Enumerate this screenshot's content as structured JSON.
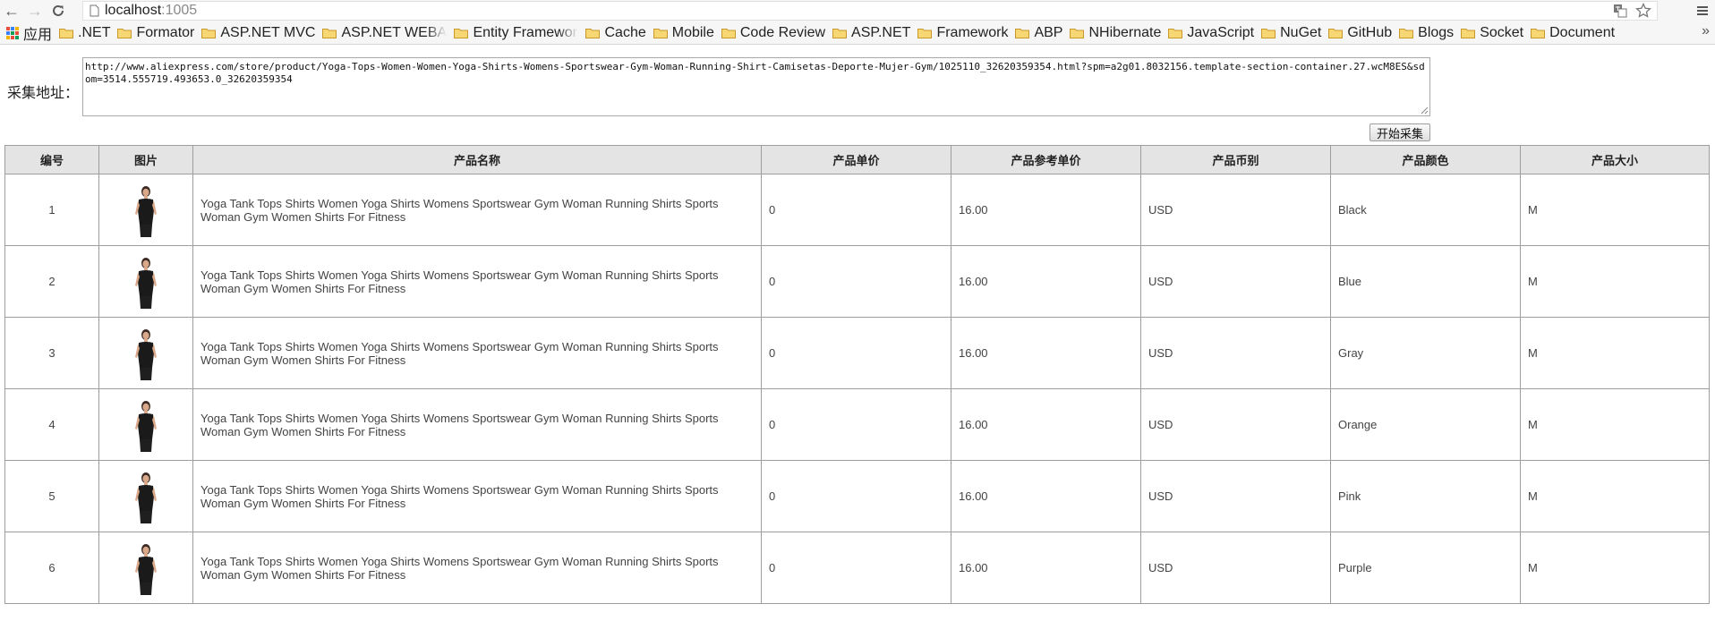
{
  "browser": {
    "url_host": "localhost",
    "url_port": ":1005",
    "bookmarks": [
      {
        "label": "应用",
        "icon": "apps-grid-icon"
      },
      {
        "label": ".NET",
        "icon": "folder-icon"
      },
      {
        "label": "Formator",
        "icon": "folder-icon"
      },
      {
        "label": "ASP.NET MVC",
        "icon": "folder-icon"
      },
      {
        "label": "ASP.NET WEBAF",
        "icon": "folder-icon"
      },
      {
        "label": "Entity Framewor",
        "icon": "folder-icon"
      },
      {
        "label": "Cache",
        "icon": "folder-icon"
      },
      {
        "label": "Mobile",
        "icon": "folder-icon"
      },
      {
        "label": "Code Review",
        "icon": "folder-icon"
      },
      {
        "label": "ASP.NET",
        "icon": "folder-icon"
      },
      {
        "label": "Framework",
        "icon": "folder-icon"
      },
      {
        "label": "ABP",
        "icon": "folder-icon"
      },
      {
        "label": "NHibernate",
        "icon": "folder-icon"
      },
      {
        "label": "JavaScript",
        "icon": "folder-icon"
      },
      {
        "label": "NuGet",
        "icon": "folder-icon"
      },
      {
        "label": "GitHub",
        "icon": "folder-icon"
      },
      {
        "label": "Blogs",
        "icon": "folder-icon"
      },
      {
        "label": "Socket",
        "icon": "folder-icon"
      },
      {
        "label": "Document",
        "icon": "folder-icon"
      }
    ],
    "overflow_glyph": "»"
  },
  "form": {
    "label": "采集地址：",
    "url_value": "http://www.aliexpress.com/store/product/Yoga-Tops-Women-Women-Yoga-Shirts-Womens-Sportswear-Gym-Woman-Running-Shirt-Camisetas-Deporte-Mujer-Gym/1025110_32620359354.html?spm=a2g01.8032156.template-section-container.27.wcM8ES&sdom=3514.555719.493653.0_32620359354",
    "start_button_label": "开始采集"
  },
  "table": {
    "headers": [
      "编号",
      "图片",
      "产品名称",
      "产品单价",
      "产品参考单价",
      "产品币别",
      "产品颜色",
      "产品大小"
    ],
    "rows": [
      {
        "id": "1",
        "name": "Yoga Tank Tops Shirts Women Yoga Shirts Womens Sportswear Gym Woman Running Shirts Sports Woman Gym Women Shirts For Fitness",
        "price": "0",
        "ref_price": "16.00",
        "currency": "USD",
        "color": "Black",
        "size": "M"
      },
      {
        "id": "2",
        "name": "Yoga Tank Tops Shirts Women Yoga Shirts Womens Sportswear Gym Woman Running Shirts Sports Woman Gym Women Shirts For Fitness",
        "price": "0",
        "ref_price": "16.00",
        "currency": "USD",
        "color": "Blue",
        "size": "M"
      },
      {
        "id": "3",
        "name": "Yoga Tank Tops Shirts Women Yoga Shirts Womens Sportswear Gym Woman Running Shirts Sports Woman Gym Women Shirts For Fitness",
        "price": "0",
        "ref_price": "16.00",
        "currency": "USD",
        "color": "Gray",
        "size": "M"
      },
      {
        "id": "4",
        "name": "Yoga Tank Tops Shirts Women Yoga Shirts Womens Sportswear Gym Woman Running Shirts Sports Woman Gym Women Shirts For Fitness",
        "price": "0",
        "ref_price": "16.00",
        "currency": "USD",
        "color": "Orange",
        "size": "M"
      },
      {
        "id": "5",
        "name": "Yoga Tank Tops Shirts Women Yoga Shirts Womens Sportswear Gym Woman Running Shirts Sports Woman Gym Women Shirts For Fitness",
        "price": "0",
        "ref_price": "16.00",
        "currency": "USD",
        "color": "Pink",
        "size": "M"
      },
      {
        "id": "6",
        "name": "Yoga Tank Tops Shirts Women Yoga Shirts Womens Sportswear Gym Woman Running Shirts Sports Woman Gym Women Shirts For Fitness",
        "price": "0",
        "ref_price": "16.00",
        "currency": "USD",
        "color": "Purple",
        "size": "M"
      }
    ]
  },
  "colors": {
    "header_bg": "#e4e4e4",
    "border": "#9d9d9d",
    "folder": "#e8b84a"
  }
}
